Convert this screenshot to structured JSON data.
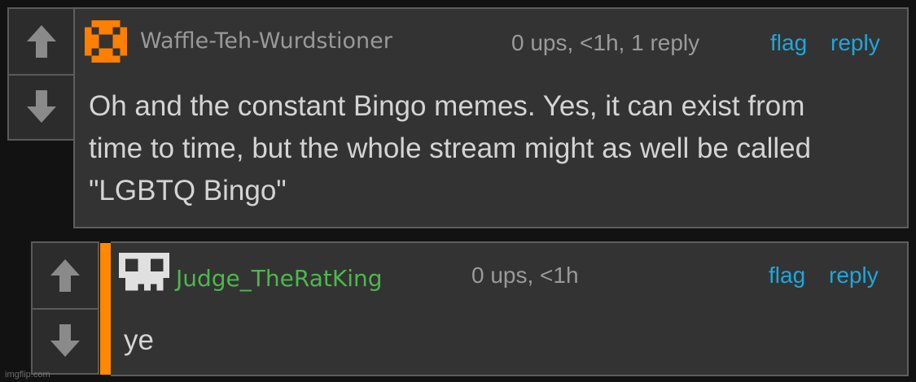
{
  "colors": {
    "background": "#121212",
    "panel": "#333333",
    "link": "#1ea7db",
    "meta": "#9a9a9a",
    "username_1": "#999999",
    "username_2": "#4cb84c",
    "thread_accent": "#ff8800",
    "avatar_1": "#ff7f00",
    "avatar_2": "#e0e0e0"
  },
  "comments": [
    {
      "username": "Waffle-Teh-Wurdstioner",
      "meta": "0 ups, <1h, 1 reply",
      "flag_label": "flag",
      "reply_label": "reply",
      "text": "Oh and the constant Bingo memes. Yes, it can exist from time to time, but the whole stream might as well be called \"LGBTQ Bingo\"",
      "avatar_icon": "pixel-cross-avatar-icon"
    },
    {
      "username": "Judge_TheRatKing",
      "meta": "0 ups, <1h",
      "flag_label": "flag",
      "reply_label": "reply",
      "text": "ye",
      "avatar_icon": "pixel-skull-avatar-icon"
    }
  ],
  "watermark": "imgflip.com"
}
